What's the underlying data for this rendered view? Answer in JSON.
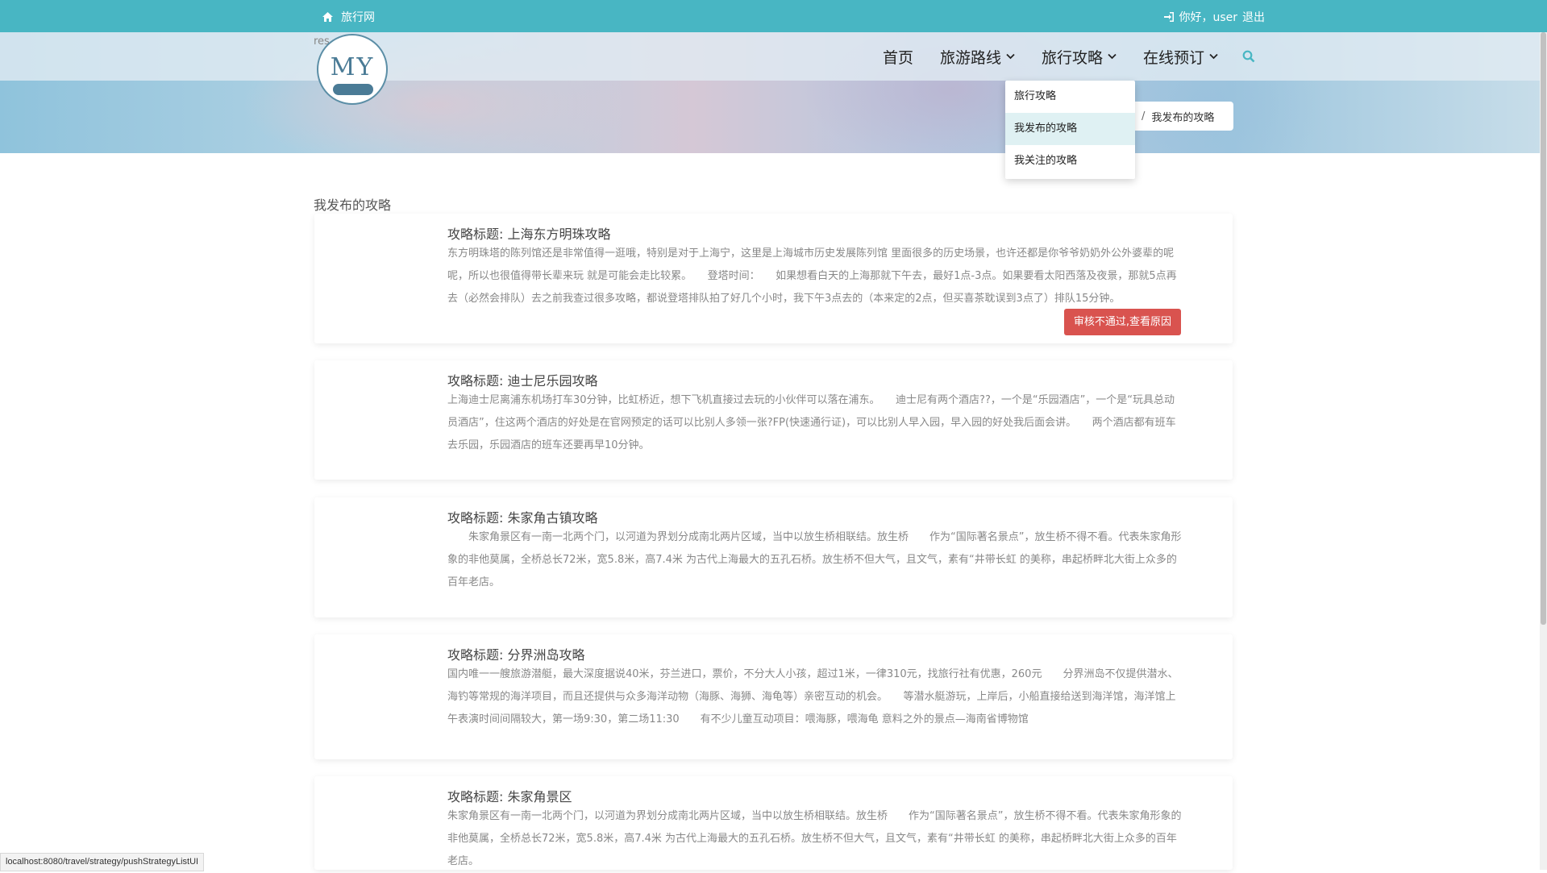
{
  "topbar": {
    "site_name": "旅行网",
    "greeting": "你好，user",
    "logout": "退出"
  },
  "logo": {
    "text": "MY",
    "alt_fragment": "res"
  },
  "nav": {
    "home": "首页",
    "routes": "旅游路线",
    "strategy": "旅行攻略",
    "booking": "在线预订"
  },
  "dropdown": {
    "items": [
      "旅行攻略",
      "我发布的攻略",
      "我关注的攻略"
    ]
  },
  "breadcrumb": {
    "separator": "/",
    "current": "我发布的攻略"
  },
  "page": {
    "heading": "我发布的攻略"
  },
  "strategies": [
    {
      "title": "攻略标题: 上海东方明珠攻略",
      "body": "东方明珠塔的陈列馆还是非常值得一逛哦，特别是对于上海宁，这里是上海城市历史发展陈列馆 里面很多的历史场景，也许还都是你爷爷奶奶外公外婆辈的呢呢，所以也很值得带长辈来玩 就是可能会走比较累。　　登塔时间：　　如果想看白天的上海那就下午去，最好1点-3点。如果要看太阳西落及夜景，那就5点再去（必然会排队）去之前我查过很多攻略，都说登塔排队拍了好几个小时，我下午3点去的（本来定的2点，但买喜茶耽误到3点了）排队15分钟。",
      "action": "审核不通过,查看原因"
    },
    {
      "title": "攻略标题: 迪士尼乐园攻略",
      "body": "上海迪士尼离浦东机场打车30分钟，比虹桥近，想下飞机直接过去玩的小伙伴可以落在浦东。　　迪士尼有两个酒店??，一个是“乐园酒店”，一个是“玩具总动员酒店”，住这两个酒店的好处是在官网预定的话可以比别人多领一张?FP(快速通行证)，可以比别人早入园，早入园的好处我后面会讲。　　两个酒店都有班车去乐园，乐园酒店的班车还要再早10分钟。"
    },
    {
      "title": "攻略标题: 朱家角古镇攻略",
      "body": "　　朱家角景区有一南一北两个门，以河道为界划分成南北两片区域，当中以放生桥相联结。放生桥　　作为“国际著名景点”，放生桥不得不看。代表朱家角形象的非他莫属，全桥总长72米，宽5.8米，高7.4米 为古代上海最大的五孔石桥。放生桥不但大气，且文气，素有“井带长虹 的美称，串起桥畔北大街上众多的百年老店。"
    },
    {
      "title": "攻略标题: 分界洲岛攻略",
      "body": "国内唯一一艘旅游潜艇，最大深度据说40米，芬兰进口，票价，不分大人小孩，超过1米，一律310元，找旅行社有优惠，260元　　分界洲岛不仅提供潜水、海钓等常规的海洋项目，而且还提供与众多海洋动物（海豚、海狮、海龟等）亲密互动的机会。　　等潜水艇游玩，上岸后，小船直接给送到海洋馆，海洋馆上午表演时间间隔较大，第一场9:30，第二场11:30　　有不少儿童互动项目：喂海豚，喂海龟 意料之外的景点—海南省博物馆"
    },
    {
      "title": "攻略标题: 朱家角景区",
      "body": "朱家角景区有一南一北两个门，以河道为界划分成南北两片区域，当中以放生桥相联结。放生桥　　作为“国际著名景点”，放生桥不得不看。代表朱家角形象的非他莫属，全桥总长72米，宽5.8米，高7.4米 为古代上海最大的五孔石桥。放生桥不但大气，且文气，素有“井带长虹 的美称，串起桥畔北大街上众多的百年老店。"
    }
  ],
  "statusbar": {
    "url": "localhost:8080/travel/strategy/pushStrategyListUI"
  },
  "colors": {
    "topbar": "#48b6c3",
    "danger": "#d9534f",
    "dropdown_active": "#dff1f3"
  },
  "icons": [
    "home-icon",
    "sign-in-icon",
    "chevron-down-icon",
    "search-icon"
  ]
}
